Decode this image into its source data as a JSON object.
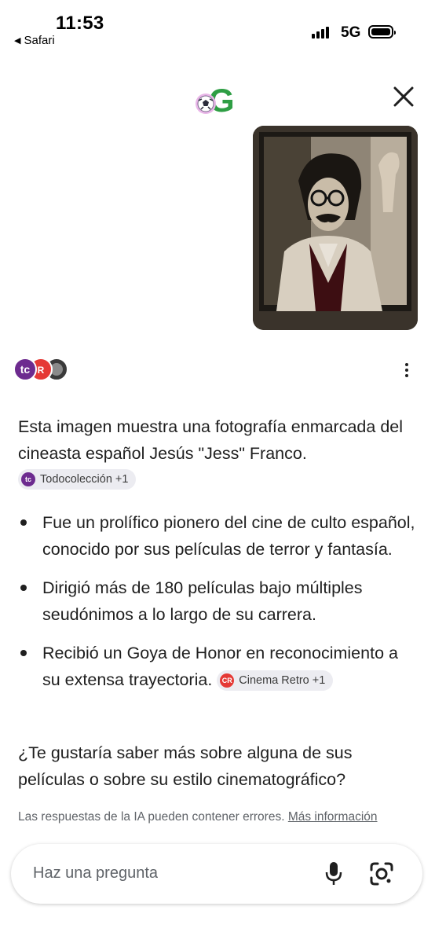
{
  "status_bar": {
    "time": "11:53",
    "back_app": "Safari",
    "network": "5G"
  },
  "header": {
    "logo_icon": "google-soccer-doodle-logo",
    "close_icon": "close-icon"
  },
  "user_image": {
    "icon": "framed-black-and-white-portrait-photo"
  },
  "sources": {
    "icons": [
      "todocoleccion-icon",
      "cinema-retro-icon",
      "source-icon"
    ],
    "more_icon": "more-vert-icon"
  },
  "answer": {
    "intro": "Esta imagen muestra una fotografía enmarcada del cineasta español Jesús \"Jess\" Franco.",
    "intro_chip": {
      "logo": "tc",
      "label": "Todocolección +1"
    },
    "bullets": [
      {
        "text": "Fue un prolífico pionero del cine de culto español, conocido por sus películas de terror y fantasía."
      },
      {
        "text": "Dirigió más de 180 películas bajo múltiples seudónimos a lo largo de su carrera."
      },
      {
        "text": "Recibió un Goya de Honor en reconocimiento a su extensa trayectoria.",
        "chip": {
          "logo": "CR",
          "label": "Cinema Retro +1"
        }
      }
    ],
    "question": "¿Te gustaría saber más sobre alguna de sus películas o sobre su estilo cinematográfico?"
  },
  "disclaimer": {
    "text": "Las respuestas de la IA pueden contener errores.",
    "link": "Más información"
  },
  "ask_bar": {
    "placeholder": "Haz una pregunta",
    "mic_icon": "mic-icon",
    "lens_icon": "google-lens-icon"
  },
  "colors": {
    "text": "#1f1f1f",
    "muted": "#5f6368",
    "chip_bg": "#ececf1",
    "todocoleccion": "#6d2b8f",
    "cinema_retro": "#e53935"
  }
}
